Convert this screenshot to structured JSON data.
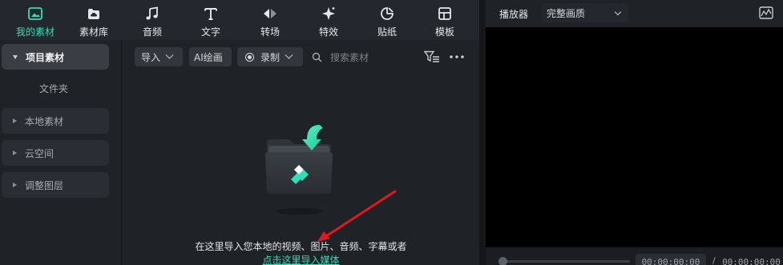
{
  "toolbar": {
    "tabs": [
      {
        "label": "我的素材",
        "icon": "media-icon",
        "active": true
      },
      {
        "label": "素材库",
        "icon": "cloud-library-icon"
      },
      {
        "label": "音频",
        "icon": "music-note-icon"
      },
      {
        "label": "文字",
        "icon": "text-icon"
      },
      {
        "label": "转场",
        "icon": "transition-icon"
      },
      {
        "label": "特效",
        "icon": "effects-icon"
      },
      {
        "label": "贴纸",
        "icon": "sticker-icon"
      },
      {
        "label": "模板",
        "icon": "template-icon"
      }
    ]
  },
  "sidebar": {
    "project_media": "项目素材",
    "folder": "文件夹",
    "items": [
      "本地素材",
      "云空间",
      "调整图层"
    ]
  },
  "media_bar": {
    "import": "导入",
    "ai_paint": "AI绘画",
    "record": "录制",
    "search_placeholder": "搜索素材"
  },
  "empty_state": {
    "hint": "在这里导入您本地的视频、图片、音频、字幕或者",
    "link": "点击这里导入媒体"
  },
  "player": {
    "title": "播放器",
    "quality": "完整画质",
    "current_time": "00:00:00:00",
    "separator": "/",
    "total_time": "00:00:00:00"
  },
  "colors": {
    "accent": "#2ee0b8",
    "annotation_arrow": "#e0191f"
  }
}
